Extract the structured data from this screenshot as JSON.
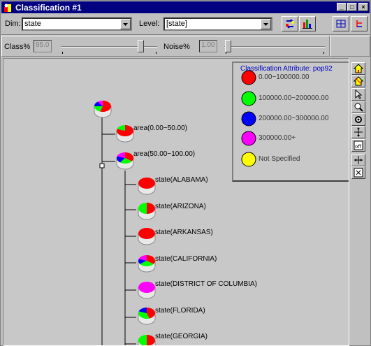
{
  "window": {
    "title": "Classification #1",
    "minimize": "_",
    "maximize": "□",
    "close": "×"
  },
  "controls": {
    "dim_label": "Dim:",
    "dim_value": "state",
    "level_label": "Level:",
    "level_value": "[state]",
    "class_label": "Class%",
    "class_value": "85.0",
    "class_level": 0.85,
    "noise_label": "Noise%",
    "noise_value": "1.00",
    "noise_level": 0.01
  },
  "legend": {
    "title": "Classification Attribute: pop92",
    "items": [
      {
        "label": "0.00~100000.00",
        "color": "#ff0000"
      },
      {
        "label": "100000.00~200000.00",
        "color": "#00ff00"
      },
      {
        "label": "200000.00~300000.00",
        "color": "#0000ff"
      },
      {
        "label": "300000.00+",
        "color": "#ff00ff"
      },
      {
        "label": "Not Specified",
        "color": "#ffff00"
      }
    ]
  },
  "tree": {
    "nodes": [
      {
        "label": "area(0.00~50.00)"
      },
      {
        "label": "area(50.00~100.00)"
      },
      {
        "label": "state(ALABAMA)"
      },
      {
        "label": "state(ARIZONA)"
      },
      {
        "label": "state(ARKANSAS)"
      },
      {
        "label": "state(CALIFORNIA)"
      },
      {
        "label": "state(DISTRICT OF COLUMBIA)"
      },
      {
        "label": "state(FLORIDA)"
      },
      {
        "label": "state(GEORGIA)"
      }
    ]
  },
  "tools": [
    "home-up-icon",
    "home-icon",
    "select-arrow-icon",
    "zoom-icon",
    "settings-icon",
    "pan-icon",
    "node-off-icon",
    "move-icon",
    "node-toggle-icon"
  ]
}
